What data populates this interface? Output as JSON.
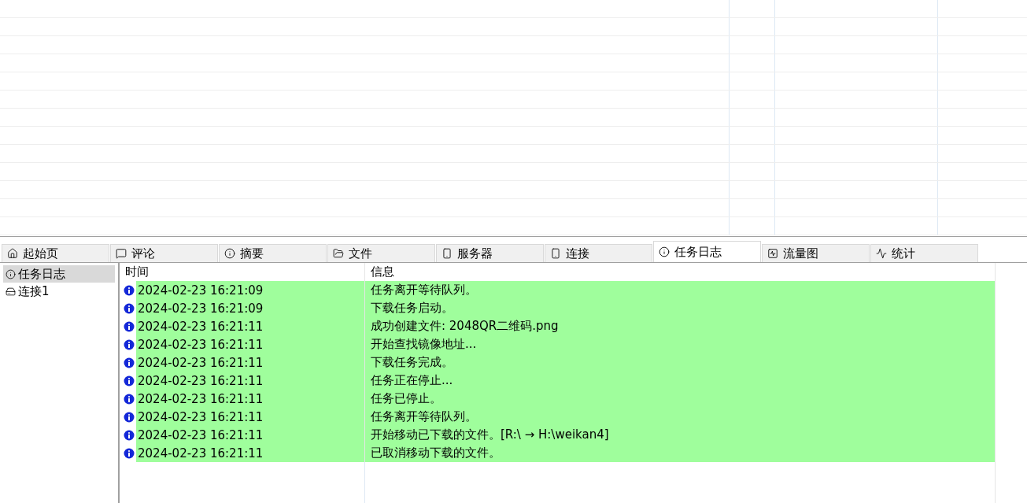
{
  "tabs": [
    {
      "label": "起始页",
      "selected": false
    },
    {
      "label": "评论",
      "selected": false
    },
    {
      "label": "摘要",
      "selected": false
    },
    {
      "label": "文件",
      "selected": false
    },
    {
      "label": "服务器",
      "selected": false
    },
    {
      "label": "连接",
      "selected": false
    },
    {
      "label": "任务日志",
      "selected": true
    },
    {
      "label": "流量图",
      "selected": false
    },
    {
      "label": "统计",
      "selected": false
    }
  ],
  "sidebar": {
    "items": [
      {
        "label": "任务日志",
        "kind": "log",
        "selected": true
      },
      {
        "label": "连接1",
        "kind": "drive",
        "selected": false
      }
    ]
  },
  "log": {
    "columns": [
      "时间",
      "信息"
    ],
    "rows": [
      {
        "kind": "info",
        "time": "2024-02-23 16:21:09",
        "message": "任务离开等待队列。"
      },
      {
        "kind": "info",
        "time": "2024-02-23 16:21:09",
        "message": "下载任务启动。"
      },
      {
        "kind": "info",
        "time": "2024-02-23 16:21:11",
        "message": "成功创建文件: 2048QR二维码.png"
      },
      {
        "kind": "info",
        "time": "2024-02-23 16:21:11",
        "message": "开始查找镜像地址..."
      },
      {
        "kind": "info",
        "time": "2024-02-23 16:21:11",
        "message": "下载任务完成。"
      },
      {
        "kind": "info",
        "time": "2024-02-23 16:21:11",
        "message": "任务正在停止..."
      },
      {
        "kind": "info",
        "time": "2024-02-23 16:21:11",
        "message": "任务已停止。"
      },
      {
        "kind": "info",
        "time": "2024-02-23 16:21:11",
        "message": "任务离开等待队列。"
      },
      {
        "kind": "info",
        "time": "2024-02-23 16:21:11",
        "message": "开始移动已下载的文件。[R:\\ → H:\\weikan4]"
      },
      {
        "kind": "info",
        "time": "2024-02-23 16:21:11",
        "message": "已取消移动下载的文件。"
      }
    ]
  }
}
